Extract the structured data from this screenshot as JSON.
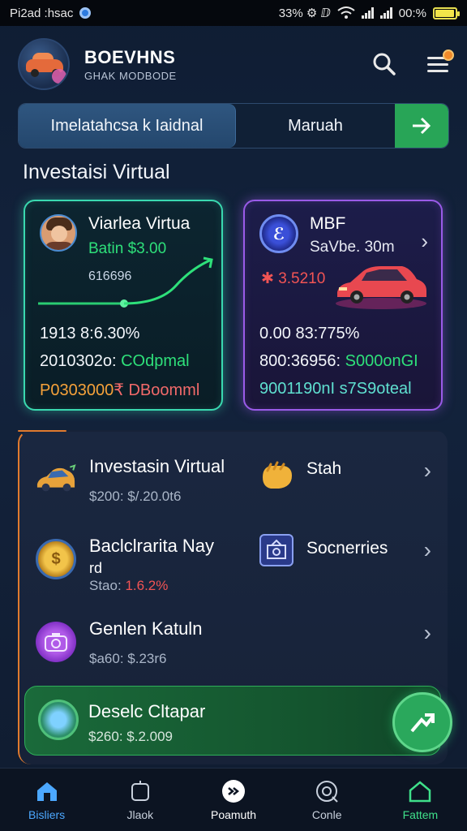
{
  "status_bar": {
    "left_text": "Pi2ad :hsac",
    "right_text": "33% ⚙ ⅅ",
    "battery_text": "00:%",
    "battery_level": 0.95
  },
  "header": {
    "brand_name": "BOEVHNS",
    "brand_sub": "GHAK MODBODE",
    "search_icon": "search-icon",
    "menu_icon": "menu-icon"
  },
  "segment": {
    "left_label": "Imelatahcsa k Iaidnal",
    "right_label": "Maruah",
    "go_icon": "arrow-right-icon"
  },
  "section_title": "Investaisi Virtual",
  "cards": {
    "left": {
      "title": "Viarlea Virtua",
      "green_line": "Batin $3.00",
      "sub_line": "616696",
      "stat1": "1913 8:6.30%",
      "stat2_prefix": "2010302o:",
      "stat2_hl": "COdpmal",
      "stat3_prefix": "P0303000",
      "stat3_hl": "₹ DBoomml",
      "colors": {
        "border": "#3ad9b0",
        "positive": "#2ee07a",
        "warning": "#f6a23a"
      }
    },
    "right": {
      "title": "MBF",
      "sub_line": "SaVbe. 30m",
      "price": "✱ 3.5210",
      "stat1": "0.00 83:775%",
      "stat2_prefix": "800:36956:",
      "stat2_hl": "S000onGI",
      "stat3": "9001190nI s7S9oteal",
      "colors": {
        "border": "#9a5be8",
        "negative": "#f25454",
        "cyan": "#5fe0d0"
      }
    }
  },
  "list": [
    {
      "title": "Investasin Virtual",
      "sub": "$200: $/.20.0t6",
      "right_label": "Stah",
      "icon": "car-icon",
      "right_icon": "hand-icon"
    },
    {
      "title": "Baclclrarita Nay",
      "title2": "rd",
      "sub_prefix": "Stao:",
      "sub_red": "1.6.2%",
      "right_label": "Socnerries",
      "icon": "coin-icon",
      "right_icon": "safe-icon"
    },
    {
      "title": "Genlen Katuln",
      "sub": "$a60: $.23r6",
      "icon": "camera-icon"
    }
  ],
  "green_bar": {
    "title": "Deselc Cltapar",
    "sub": "$260: $.2.009",
    "icon": "globe-icon",
    "fab_icon": "trend-arrow-icon"
  },
  "bottom_nav": [
    {
      "label": "Bisliers",
      "icon": "home-icon",
      "state": "active-blue"
    },
    {
      "label": "Jlaok",
      "icon": "box-icon",
      "state": "normal"
    },
    {
      "label": "Poamuth",
      "icon": "forward-icon",
      "state": "active-white"
    },
    {
      "label": "Conle",
      "icon": "target-icon",
      "state": "normal"
    },
    {
      "label": "Fattem",
      "icon": "house-outline-icon",
      "state": "green"
    }
  ]
}
